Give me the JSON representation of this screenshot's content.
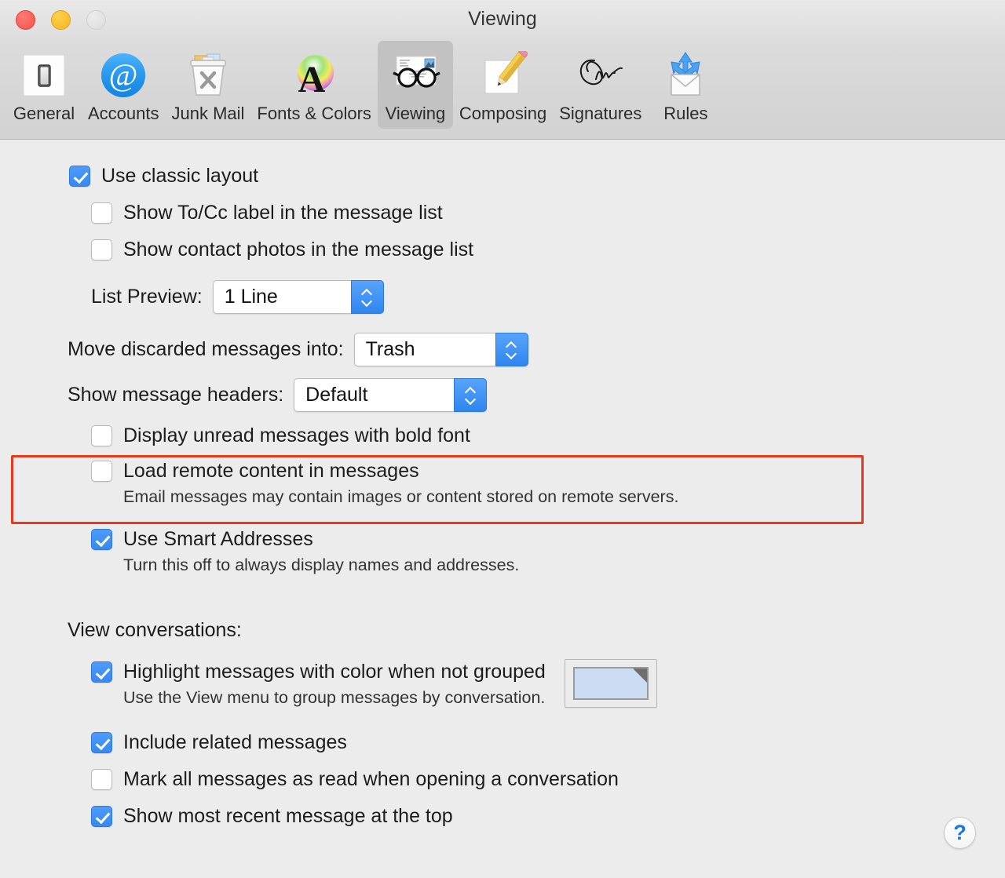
{
  "window": {
    "title": "Viewing",
    "traffic_lights": [
      {
        "name": "close",
        "color": "#f4524a"
      },
      {
        "name": "minimize",
        "color": "#f5b422"
      },
      {
        "name": "zoom",
        "color": "#dcdcdc"
      }
    ]
  },
  "toolbar": {
    "items": [
      {
        "label": "General",
        "icon": "light-switch-icon",
        "selected": false
      },
      {
        "label": "Accounts",
        "icon": "at-sign-icon",
        "selected": false
      },
      {
        "label": "Junk Mail",
        "icon": "trash-can-icon",
        "selected": false
      },
      {
        "label": "Fonts & Colors",
        "icon": "letter-a-color-icon",
        "selected": false
      },
      {
        "label": "Viewing",
        "icon": "eyeglasses-icon",
        "selected": true
      },
      {
        "label": "Composing",
        "icon": "pencil-page-icon",
        "selected": false
      },
      {
        "label": "Signatures",
        "icon": "signature-icon",
        "selected": false
      },
      {
        "label": "Rules",
        "icon": "envelope-arrows-icon",
        "selected": false
      }
    ]
  },
  "settings": {
    "use_classic_layout": {
      "label": "Use classic layout",
      "checked": true
    },
    "show_to_cc_label": {
      "label": "Show To/Cc label in the message list",
      "checked": false
    },
    "show_contact_photos": {
      "label": "Show contact photos in the message list",
      "checked": false
    },
    "list_preview": {
      "label": "List Preview:",
      "value": "1 Line"
    },
    "move_discarded": {
      "label": "Move discarded messages into:",
      "value": "Trash"
    },
    "show_message_headers": {
      "label": "Show message headers:",
      "value": "Default"
    },
    "display_unread_bold": {
      "label": "Display unread messages with bold font",
      "checked": false
    },
    "load_remote_content": {
      "label": "Load remote content in messages",
      "checked": false,
      "description": "Email messages may contain images or content stored on remote servers.",
      "highlighted": true,
      "highlight_color": "#e8391b"
    },
    "use_smart_addresses": {
      "label": "Use Smart Addresses",
      "checked": true,
      "description": "Turn this off to always display names and addresses."
    }
  },
  "conversations": {
    "heading": "View conversations:",
    "highlight_messages": {
      "label": "Highlight messages with color when not grouped",
      "checked": true,
      "description": "Use the View menu to group messages by conversation.",
      "swatch_color": "#ccdcf2"
    },
    "include_related": {
      "label": "Include related messages",
      "checked": true
    },
    "mark_all_read": {
      "label": "Mark all messages as read when opening a conversation",
      "checked": false
    },
    "show_most_recent": {
      "label": "Show most recent message at the top",
      "checked": true
    }
  },
  "help": {
    "label": "?"
  }
}
